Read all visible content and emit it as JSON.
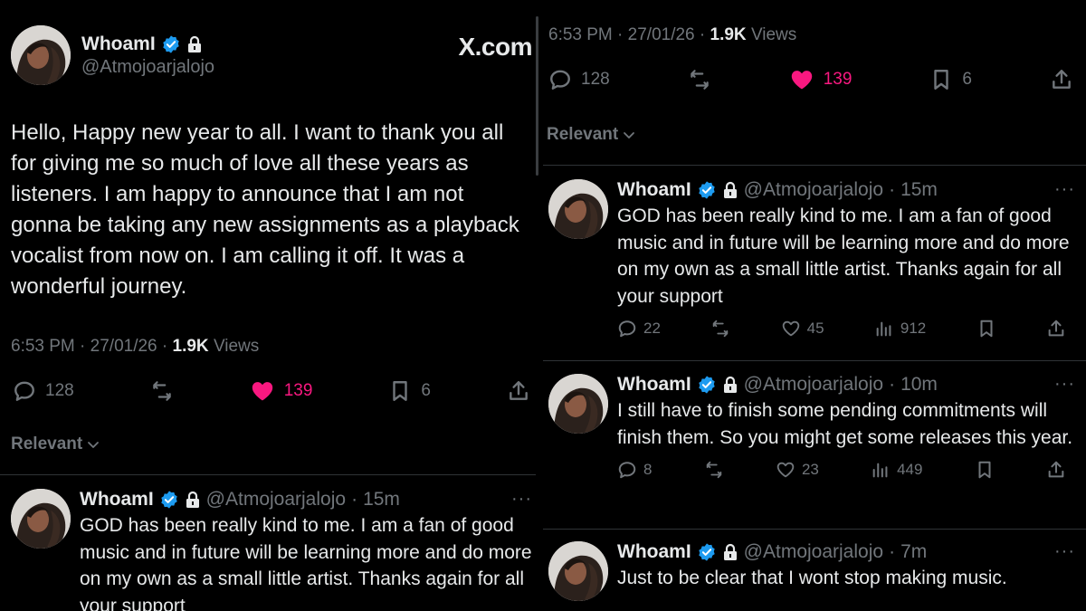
{
  "brand": {
    "site_label": "X.com"
  },
  "colors": {
    "background": "#000000",
    "text": "#e7e9ea",
    "muted": "#71767b",
    "verified": "#1d9bf0",
    "like": "#f91880",
    "divider": "#2f3336"
  },
  "author": {
    "display_name": "WhoamI",
    "handle": "@Atmojoarjalojo"
  },
  "main_post": {
    "text": "Hello, Happy new year to all. I want to thank you all for giving me so much of love all these years as listeners. I am happy to announce that I am not gonna be taking any new assignments as a playback vocalist from now on. I am calling it off. It was a wonderful journey.",
    "time": "6:53 PM",
    "date": "27/01/26",
    "views_count": "1.9K",
    "views_label": "Views",
    "replies": "128",
    "likes": "139",
    "bookmarks": "6"
  },
  "sort_label": "Relevant",
  "replies": [
    {
      "name": "WhoamI",
      "handle": "@Atmojoarjalojo",
      "age": "15m",
      "text": "GOD has been really kind to me. I am a fan of good music and in future will be learning more and do more on my own as a small little artist. Thanks again for all your support",
      "replies": "22",
      "likes": "45",
      "views": "912",
      "more": "···"
    },
    {
      "name": "WhoamI",
      "handle": "@Atmojoarjalojo",
      "age": "10m",
      "text": "I still have to finish some pending commitments will finish them. So you might get some releases this year.",
      "replies": "8",
      "likes": "23",
      "views": "449",
      "more": "···"
    },
    {
      "name": "WhoamI",
      "handle": "@Atmojoarjalojo",
      "age": "7m",
      "text": "Just to be clear that I wont stop making music.",
      "more": "···"
    }
  ],
  "separator": "·",
  "icons": [
    "verified-badge-icon",
    "lock-icon",
    "reply-icon",
    "repost-icon",
    "like-icon",
    "bookmark-icon",
    "share-icon",
    "views-icon",
    "more-icon",
    "chevron-down-icon"
  ]
}
